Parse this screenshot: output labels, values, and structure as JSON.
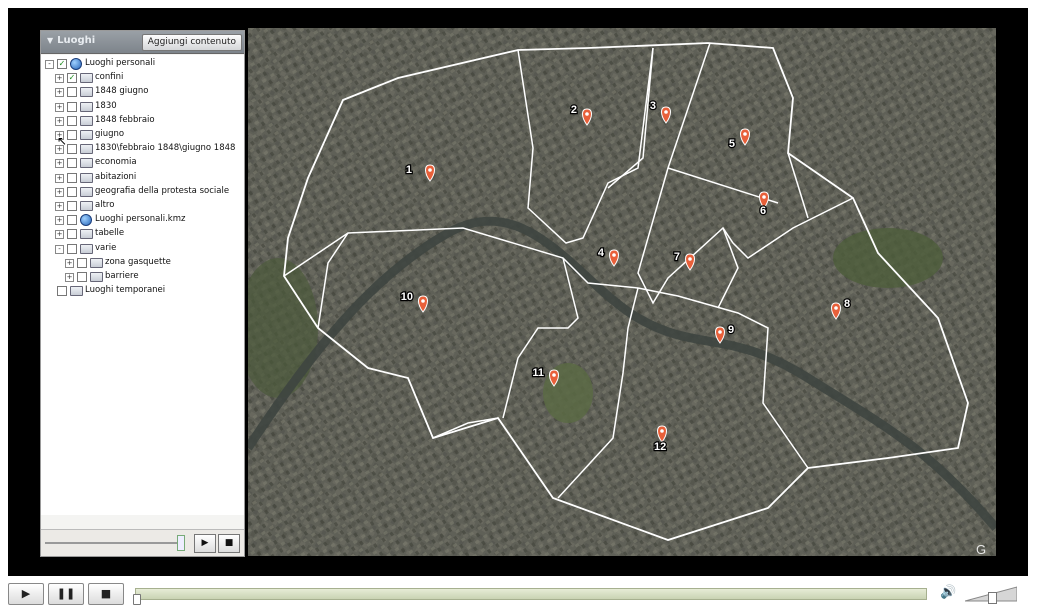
{
  "panel": {
    "title": "Luoghi",
    "add_button": "Aggiungi contenuto",
    "tree": [
      {
        "label": "Luoghi personali",
        "indent": 0,
        "expander": "-",
        "checked": true,
        "icon": "globe-icon"
      },
      {
        "label": "confini",
        "indent": 1,
        "expander": "+",
        "checked": true,
        "icon": "folder-icon"
      },
      {
        "label": "1848 giugno",
        "indent": 1,
        "expander": "+",
        "checked": false,
        "icon": "folder-icon"
      },
      {
        "label": "1830",
        "indent": 1,
        "expander": "+",
        "checked": false,
        "icon": "folder-icon"
      },
      {
        "label": "1848 febbraio",
        "indent": 1,
        "expander": "+",
        "checked": false,
        "icon": "folder-icon"
      },
      {
        "label": "giugno",
        "indent": 1,
        "expander": "+",
        "checked": false,
        "icon": "folder-icon"
      },
      {
        "label": "1830\\febbraio 1848\\giugno 1848",
        "indent": 1,
        "expander": "+",
        "checked": false,
        "icon": "folder-icon"
      },
      {
        "label": "economia",
        "indent": 1,
        "expander": "+",
        "checked": false,
        "icon": "folder-icon"
      },
      {
        "label": "abitazioni",
        "indent": 1,
        "expander": "+",
        "checked": false,
        "icon": "folder-icon"
      },
      {
        "label": "geografia della protesta sociale",
        "indent": 1,
        "expander": "+",
        "checked": false,
        "icon": "folder-icon"
      },
      {
        "label": "altro",
        "indent": 1,
        "expander": "+",
        "checked": false,
        "icon": "folder-icon"
      },
      {
        "label": "Luoghi personali.kmz",
        "indent": 1,
        "expander": "+",
        "checked": false,
        "icon": "globe-icon"
      },
      {
        "label": "tabelle",
        "indent": 1,
        "expander": "+",
        "checked": false,
        "icon": "folder-icon"
      },
      {
        "label": "varie",
        "indent": 1,
        "expander": "-",
        "checked": false,
        "icon": "folder-icon"
      },
      {
        "label": "zona gasquette",
        "indent": 2,
        "expander": "+",
        "checked": false,
        "icon": "folder-icon"
      },
      {
        "label": "barriere",
        "indent": 2,
        "expander": "+",
        "checked": false,
        "icon": "folder-icon"
      },
      {
        "label": "Luoghi temporanei",
        "indent": 0,
        "expander": "",
        "checked": false,
        "icon": "folder-icon"
      }
    ],
    "footer": {
      "play": "▶",
      "stop": "■"
    }
  },
  "map": {
    "markers": [
      {
        "label": "1"
      },
      {
        "label": "2"
      },
      {
        "label": "3"
      },
      {
        "label": "4"
      },
      {
        "label": "5"
      },
      {
        "label": "6"
      },
      {
        "label": "7"
      },
      {
        "label": "8"
      },
      {
        "label": "9"
      },
      {
        "label": "10"
      },
      {
        "label": "11"
      },
      {
        "label": "12"
      }
    ],
    "marker_color": "#e8603a",
    "boundary_color": "#ffffff"
  },
  "player": {
    "play": "▶",
    "pause": "❚❚",
    "stop": "■",
    "volume": "🔊"
  }
}
